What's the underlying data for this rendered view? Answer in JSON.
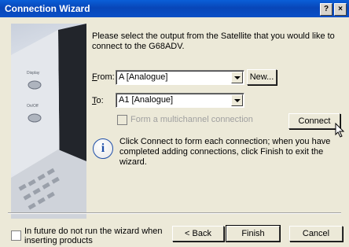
{
  "window": {
    "title": "Connection Wizard",
    "help_btn": "?",
    "close_btn": "×"
  },
  "intro": "Please select the output from the Satellite that you would like to connect to the G68ADV.",
  "from": {
    "label_pre": "",
    "label_u": "F",
    "label_post": "rom:",
    "value": "A [Analogue]",
    "new_btn": "New..."
  },
  "to": {
    "label_pre": "",
    "label_u": "T",
    "label_post": "o:",
    "value": "A1 [Analogue]"
  },
  "multichannel": {
    "label": "Form a multichannel connection"
  },
  "connect_btn": "Connect",
  "info_text": "Click Connect to form each connection; when you have completed adding connections, click Finish to exit the wizard.",
  "footer": {
    "checkbox_label": "In future do not run the wizard when inserting products",
    "back_btn": "< Back",
    "finish_btn": "Finish",
    "cancel_btn": "Cancel"
  },
  "art_labels": {
    "display": "Display",
    "on_off": "On/Off"
  }
}
